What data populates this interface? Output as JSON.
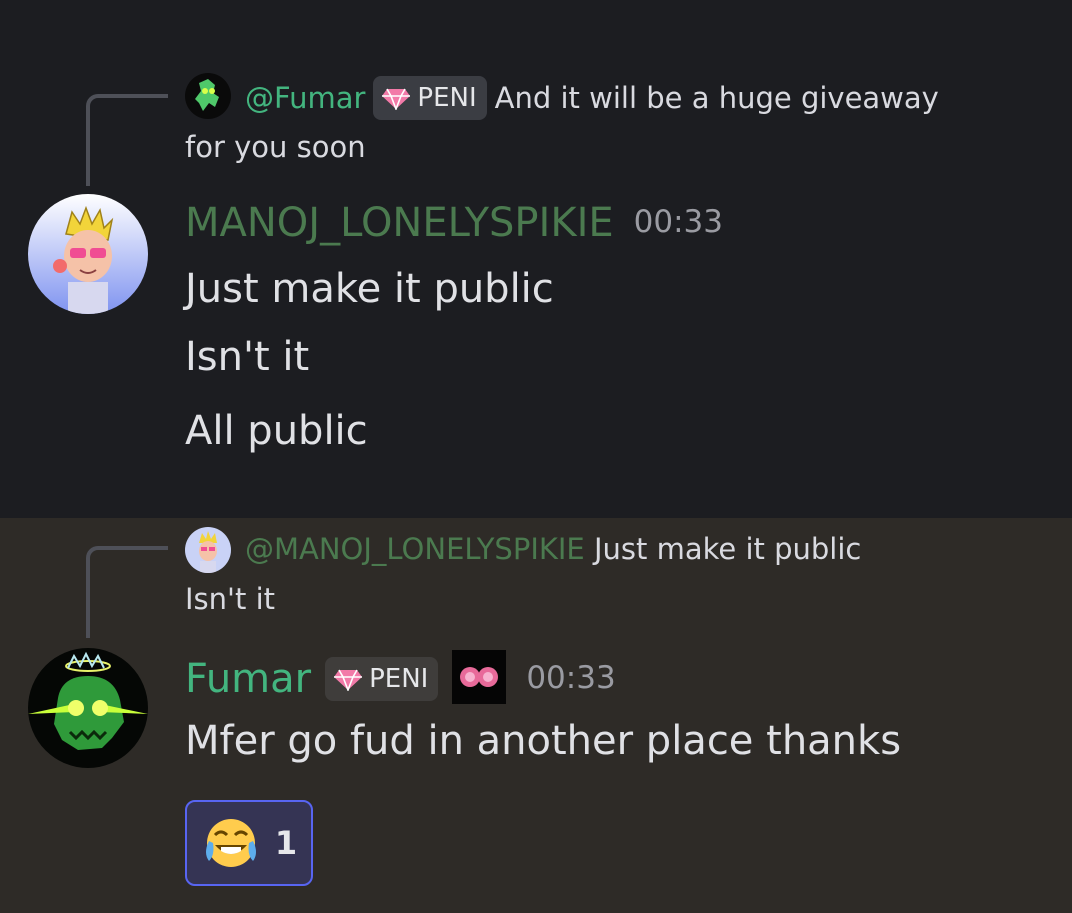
{
  "messages": [
    {
      "reply": {
        "mention": "@Fumar",
        "badge": "PENI",
        "text_line1": "And it will be a huge giveaway",
        "text_line2": "for you soon"
      },
      "author": "MANOJ_LONELYSPIKIE",
      "time": "00:33",
      "lines": [
        "Just make it public",
        "Isn't it",
        "All public"
      ]
    },
    {
      "reply": {
        "mention": "@MANOJ_LONELYSPIKIE",
        "text_line1": "Just make it public",
        "text_line2": "Isn't it"
      },
      "author": "Fumar",
      "badge": "PENI",
      "time": "00:33",
      "lines": [
        "Mfer go fud in another place thanks"
      ],
      "reaction": {
        "emoji": "joy-emoji",
        "count": "1"
      }
    }
  ],
  "colors": {
    "bg_top": "#1c1d21",
    "bg_bottom": "#2e2b27",
    "fumar_name": "#43b57f",
    "manoj_name": "#4b7a4f",
    "reaction_border": "#5865f2"
  }
}
